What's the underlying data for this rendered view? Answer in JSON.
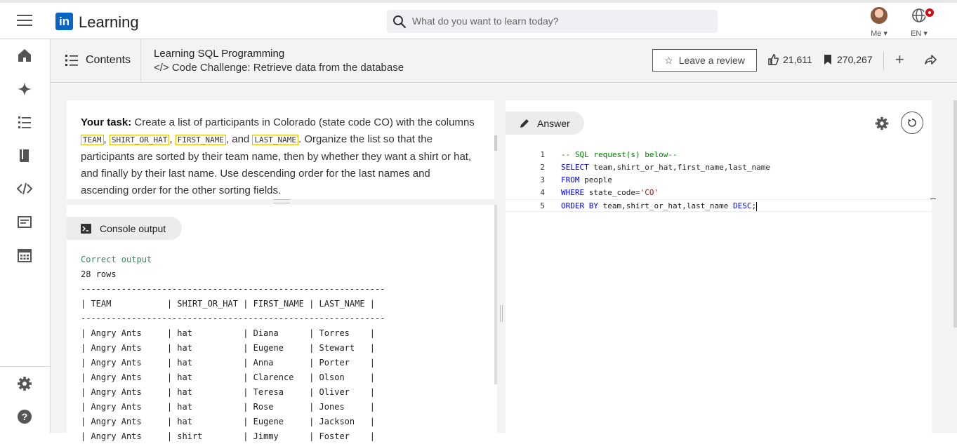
{
  "header": {
    "logo_mark": "in",
    "logo_text": "Learning",
    "search_placeholder": "What do you want to learn today?",
    "me_label": "Me",
    "lang_label": "EN"
  },
  "crumb": {
    "contents_label": "Contents",
    "course_title": "Learning SQL Programming",
    "video_title": "</> Code Challenge: Retrieve data from the database",
    "review_label": "Leave a review",
    "likes": "21,611",
    "saves": "270,267"
  },
  "task": {
    "lead": "Your task:",
    "t1": " Create a list of participants in Colorado (state code CO) with the columns ",
    "c1": "TEAM",
    "s1": ", ",
    "c2": "SHIRT_OR_HAT",
    "s2": ", ",
    "c3": "FIRST_NAME",
    "s3": ", and ",
    "c4": "LAST_NAME",
    "t2": ". Organize the list so that the participants are sorted by their team name, then by whether they want a shirt or hat, and finally by their last name. Use descending order for the last names and ascending order for the other sorting fields."
  },
  "console": {
    "tab_label": "Console output",
    "status": "Correct output",
    "rows": "28 rows",
    "rule": "------------------------------------------------------------",
    "header": "| TEAM           | SHIRT_OR_HAT | FIRST_NAME | LAST_NAME |",
    "lines": [
      "| Angry Ants     | hat          | Diana      | Torres    |",
      "| Angry Ants     | hat          | Eugene     | Stewart   |",
      "| Angry Ants     | hat          | Anna       | Porter    |",
      "| Angry Ants     | hat          | Clarence   | Olson     |",
      "| Angry Ants     | hat          | Teresa     | Oliver    |",
      "| Angry Ants     | hat          | Rose       | Jones     |",
      "| Angry Ants     | hat          | Eugene     | Jackson   |",
      "| Angry Ants     | shirt        | Jimmy      | Foster    |"
    ]
  },
  "editor": {
    "tab_label": "Answer",
    "line_numbers": [
      "1",
      "2",
      "3",
      "4",
      "5"
    ],
    "l1": "-- SQL request(s) below--",
    "l2_kw": "SELECT",
    "l2_rest": " team,shirt_or_hat,first_name,last_name",
    "l3_kw": "FROM",
    "l3_rest": " people",
    "l4_kw": "WHERE",
    "l4_rest": " state_code=",
    "l4_str": "'CO'",
    "l5_kw": "ORDER BY",
    "l5_rest": " team,shirt_or_hat,last_name ",
    "l5_kw2": "DESC",
    "l5_end": ";"
  },
  "colors": {
    "brand": "#0a66c2",
    "correct": "#2e8b57",
    "keyword": "#0000ff",
    "comment": "#008000",
    "string": "#a31515",
    "highlight_border": "#e6b800"
  },
  "icons": [
    "menu-icon",
    "search-icon",
    "globe-icon",
    "home-icon",
    "sparkle-icon",
    "list-icon",
    "book-icon",
    "code-icon",
    "certificate-icon",
    "calendar-icon",
    "settings-icon",
    "help-icon",
    "star-icon",
    "thumbs-up-icon",
    "bookmark-icon",
    "plus-icon",
    "share-icon",
    "pencil-icon",
    "terminal-icon",
    "gear-icon",
    "reset-icon"
  ]
}
